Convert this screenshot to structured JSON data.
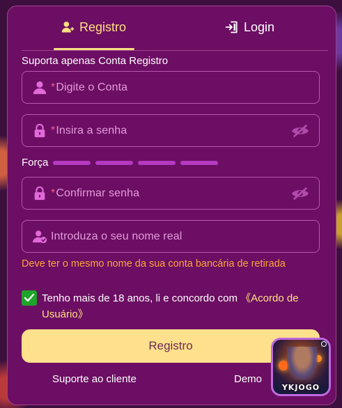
{
  "tabs": {
    "register_label": "Registro",
    "login_label": "Login"
  },
  "form": {
    "section_title": "Suporta apenas Conta Registro",
    "account": {
      "required_mark": "*",
      "placeholder": "Digite o Conta"
    },
    "password": {
      "required_mark": "*",
      "placeholder": "Insira a senha"
    },
    "strength": {
      "label": "Força",
      "segments": 4,
      "level": 0
    },
    "confirm": {
      "required_mark": "*",
      "placeholder": "Confirmar senha"
    },
    "real_name": {
      "placeholder": "Introduza o seu nome real"
    },
    "name_warning": "Deve ter o mesmo nome da sua conta bancária de retirada",
    "agreement": {
      "checked": true,
      "text": "Tenho mais de 18 anos, li e concordo com ",
      "link": "《Acordo de Usuário》"
    },
    "submit_label": "Registro"
  },
  "footer": {
    "support_label": "Suporte ao cliente",
    "demo_label": "Demo"
  },
  "badge": {
    "label": "YKJOGO"
  },
  "colors": {
    "panel": "#6c0e63",
    "accent": "#ffe082",
    "placeholder": "#e59bde",
    "required": "#f05a8e",
    "warning": "#ffa53d",
    "checkbox": "#1fa32a",
    "strength_bar": "#b43ac0"
  },
  "icons": {
    "register_tab": "user-plus-icon",
    "login_tab": "login-door-icon",
    "account": "user-icon",
    "password": "lock-icon",
    "confirm": "lock-icon",
    "real_name": "user-check-icon",
    "toggle": "eye-off-icon",
    "checkbox": "check-icon"
  }
}
